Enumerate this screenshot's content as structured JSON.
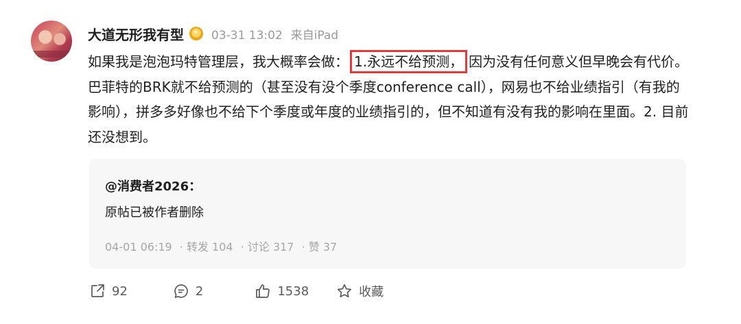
{
  "post": {
    "username": "大道无形我有型",
    "date": "03-31 13:02",
    "source": "来自iPad",
    "content_before": "如果我是泡泡玛特管理层，我大概率会做：",
    "content_highlight": "1.永远不给预测，",
    "content_after": "因为没有任何意义但早晚会有代价。巴菲特的BRK就不给预测的（甚至没有没个季度conference call），网易也不给业绩指引（有我的影响），拼多多好像也不给下个季度或年度的业绩指引的，但不知道有没有我的影响在里面。2. 目前还没想到。"
  },
  "quoted": {
    "author": "@消费者2026：",
    "text": "原帖已被作者删除",
    "date": "04-01 06:19",
    "reposts": "· 转发 104",
    "comments": "· 讨论 317",
    "likes": "· 赞 37"
  },
  "actions": {
    "share_count": "92",
    "comment_count": "2",
    "like_count": "1538",
    "favorite_label": "收藏"
  },
  "colors": {
    "highlight_border": "#e63a3a",
    "meta_text": "#9a9a9a",
    "quote_bg": "#f7f7f7"
  }
}
